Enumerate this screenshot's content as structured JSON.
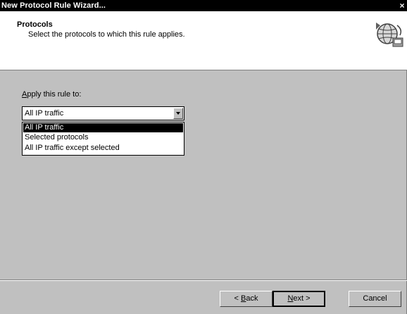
{
  "window": {
    "title": "New Protocol Rule Wizard...",
    "close_glyph": "×"
  },
  "header": {
    "heading": "Protocols",
    "subheading": "Select the protocols to which this rule applies.",
    "icon": "globe-network-icon"
  },
  "apply": {
    "label_mnemonic": "A",
    "label_rest": "pply this rule to:",
    "selected_value": "All IP traffic",
    "options": [
      "All IP traffic",
      "Selected protocols",
      "All IP traffic except selected"
    ],
    "highlighted_index": 0
  },
  "buttons": {
    "back_prefix": "< ",
    "back_mnemonic": "B",
    "back_rest": "ack",
    "next_mnemonic": "N",
    "next_rest": "ext >",
    "cancel": "Cancel"
  },
  "colors": {
    "dialog_face": "#c0c0c0",
    "title_bar": "#000000",
    "highlight": "#000000"
  }
}
